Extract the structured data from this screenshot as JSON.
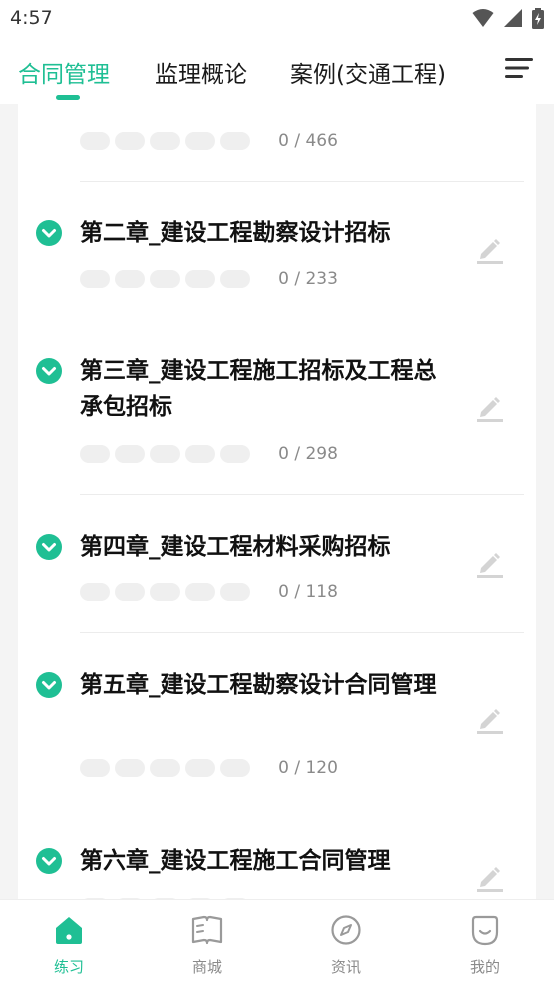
{
  "status_bar": {
    "time": "4:57"
  },
  "tabs": [
    {
      "label": "合同管理",
      "active": true
    },
    {
      "label": "监理概论",
      "active": false
    },
    {
      "label": "案例(交通工程)",
      "active": false
    }
  ],
  "chapters": [
    {
      "title": "",
      "count": "0 / 466"
    },
    {
      "title": "第二章_建设工程勘察设计招标",
      "count": "0 / 233"
    },
    {
      "title": "第三章_建设工程施工招标及工程总承包招标",
      "count": "0 / 298"
    },
    {
      "title": "第四章_建设工程材料采购招标",
      "count": "0 / 118"
    },
    {
      "title": "第五章_建设工程勘察设计合同管理",
      "count": "0 / 120"
    },
    {
      "title": "第六章_建设工程施工合同管理",
      "count": ""
    }
  ],
  "bottom_nav": [
    {
      "label": "练习",
      "icon": "home-icon",
      "active": true
    },
    {
      "label": "商城",
      "icon": "book-icon",
      "active": false
    },
    {
      "label": "资讯",
      "icon": "compass-icon",
      "active": false
    },
    {
      "label": "我的",
      "icon": "smile-icon",
      "active": false
    }
  ],
  "colors": {
    "accent": "#1fbf94",
    "muted": "#8a8a8a",
    "pill": "#efefef"
  }
}
